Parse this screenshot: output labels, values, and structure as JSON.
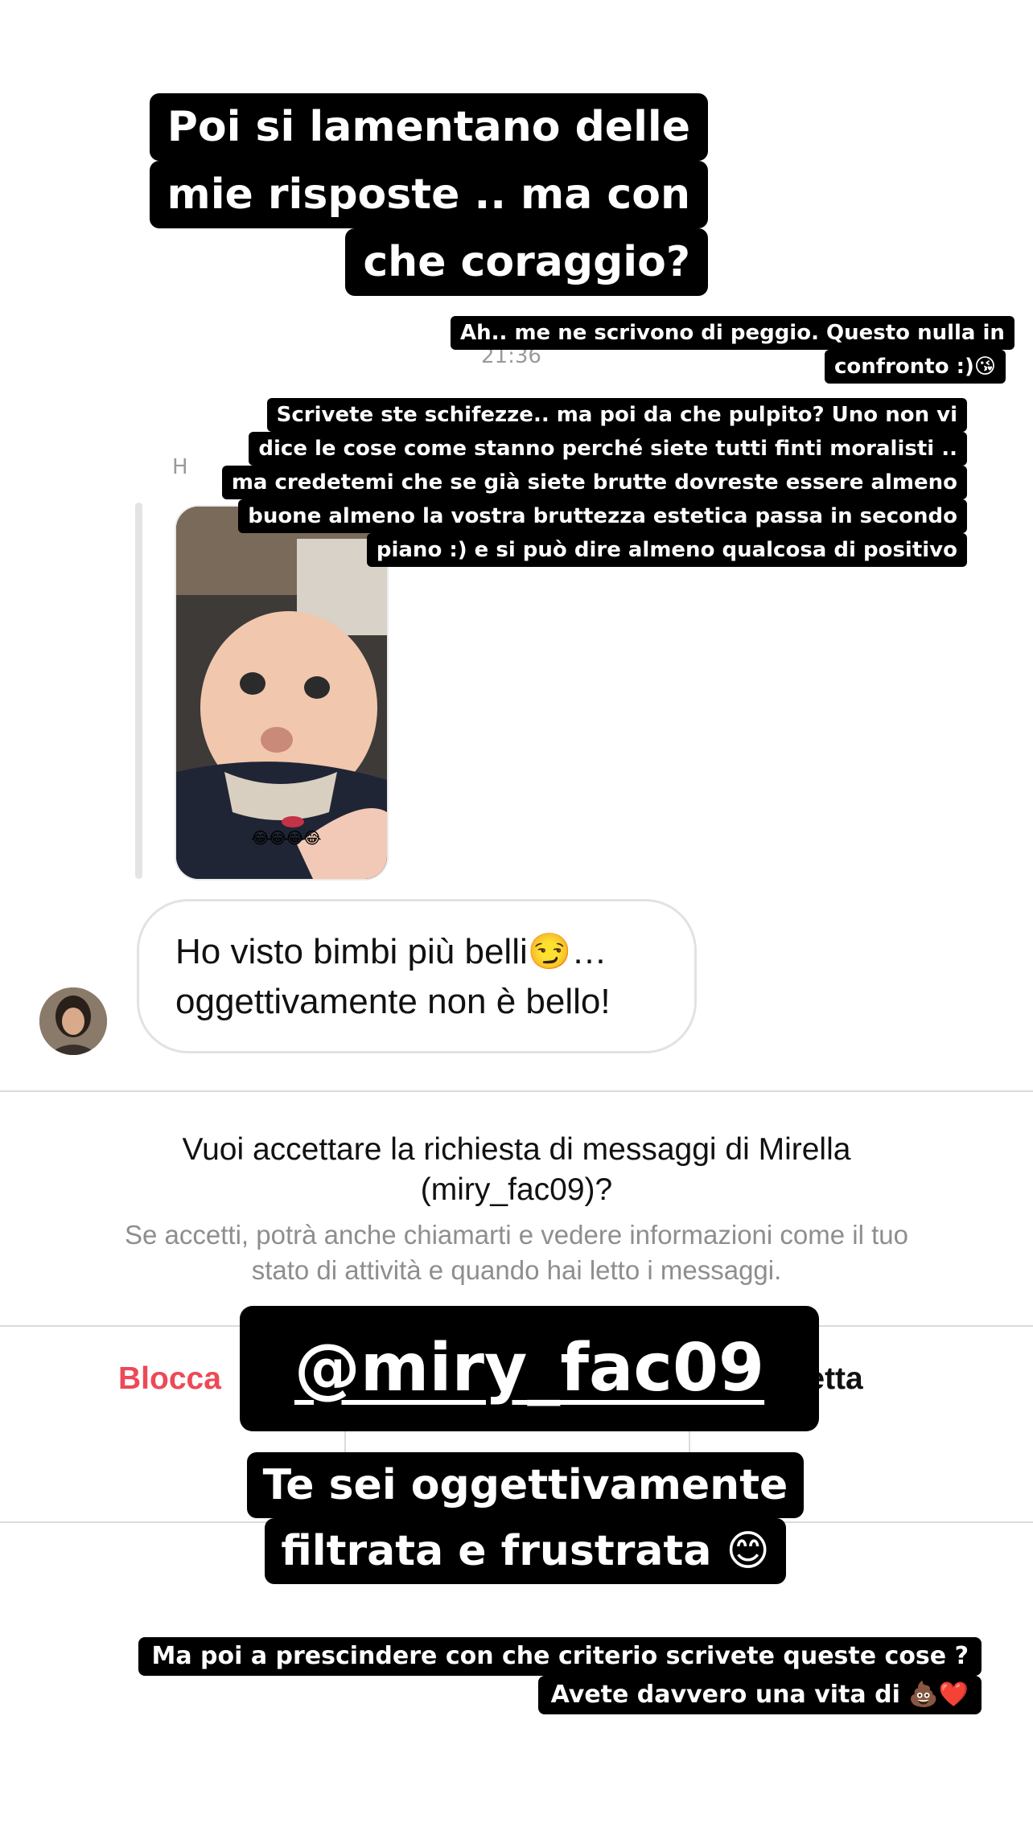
{
  "overlays": {
    "headline": [
      "Poi si lamentano delle",
      "mie risposte .. ma con",
      "che coraggio?"
    ],
    "small_note": [
      "Ah.. me ne scrivono di peggio. Questo nulla in",
      "confronto :)😘"
    ],
    "comment": [
      "Scrivete ste schifezze.. ma poi da che pulpito? Uno non vi",
      "dice le cose come stanno perché siete tutti finti moralisti ..",
      "ma credetemi che se già siete brutte dovreste essere almeno",
      "buone almeno la vostra bruttezza estetica passa in secondo",
      "piano :) e si può dire almeno qualcosa di positivo"
    ],
    "handle": "@miry_fac09",
    "verdict": [
      "Te sei oggettivamente",
      "filtrata e frustrata 😊"
    ],
    "closing": [
      "Ma poi a prescindere con che criterio scrivete queste cose ?",
      "Avete davvero una vita di 💩❤️"
    ]
  },
  "chat": {
    "timestamp": "21:36",
    "sender_fragment": "H",
    "photo_caption": "😂😂😂😂",
    "message_lines": [
      "Ho visto bimbi più belli😏…",
      "oggettivamente non è bello!"
    ]
  },
  "request": {
    "title_lines": [
      "Vuoi accettare la richiesta di messaggi di Mirella",
      "(miry_fac09)?"
    ],
    "subtitle_lines": [
      "Se accetti, potrà anche chiamarti e vedere informazioni come il tuo",
      "stato di attività e quando hai letto i messaggi."
    ],
    "block_label": "Blocca",
    "accept_label": "ccetta"
  },
  "colors": {
    "block": "#ed4956",
    "overlay_bg": "#000000",
    "bubble_border": "#e2e2e2",
    "subtitle": "#8e8e8e"
  }
}
